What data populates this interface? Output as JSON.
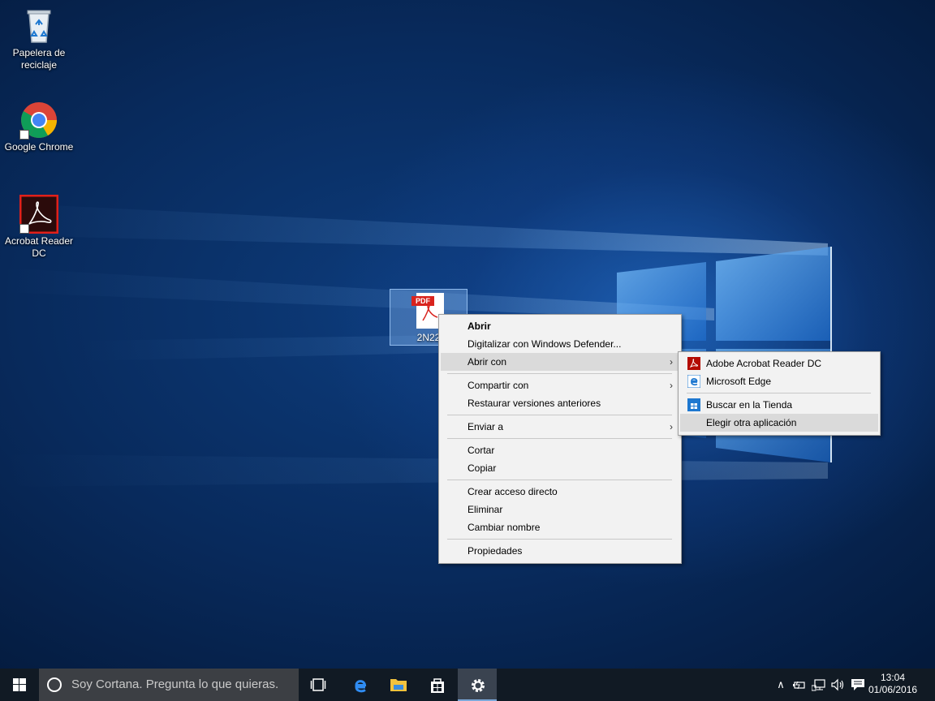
{
  "desktop": {
    "icons": [
      {
        "label": "Papelera de reciclaje",
        "icon": "recycle-bin-icon"
      },
      {
        "label": "Google Chrome",
        "icon": "chrome-icon"
      },
      {
        "label": "Acrobat Reader DC",
        "icon": "acrobat-icon"
      }
    ],
    "selected_file": {
      "name": "2N22",
      "tag": "PDF",
      "icon": "pdf-file-icon"
    }
  },
  "context_menu": {
    "items": [
      {
        "label": "Abrir"
      },
      {
        "label": "Digitalizar con Windows Defender..."
      },
      {
        "label": "Abrir con"
      },
      {
        "label": "Compartir con"
      },
      {
        "label": "Restaurar versiones anteriores"
      },
      {
        "label": "Enviar a"
      },
      {
        "label": "Cortar"
      },
      {
        "label": "Copiar"
      },
      {
        "label": "Crear acceso directo"
      },
      {
        "label": "Eliminar"
      },
      {
        "label": "Cambiar nombre"
      },
      {
        "label": "Propiedades"
      }
    ],
    "submenu_arrow": "›"
  },
  "open_with_submenu": {
    "items": [
      {
        "label": "Adobe Acrobat Reader DC",
        "icon": "acrobat-icon"
      },
      {
        "label": "Microsoft Edge",
        "icon": "edge-icon"
      },
      {
        "label": "Buscar en la Tienda",
        "icon": "store-icon"
      },
      {
        "label": "Elegir otra aplicación"
      }
    ]
  },
  "taskbar": {
    "search_placeholder": "Soy Cortana. Pregunta lo que quieras.",
    "clock_time": "13:04",
    "clock_date": "01/06/2016",
    "tray_chevron": "∧"
  },
  "colors": {
    "accent": "#0078d7",
    "pdf_red": "#d9231d",
    "menu_bg": "#f2f2f2",
    "menu_hover": "#dadada"
  }
}
